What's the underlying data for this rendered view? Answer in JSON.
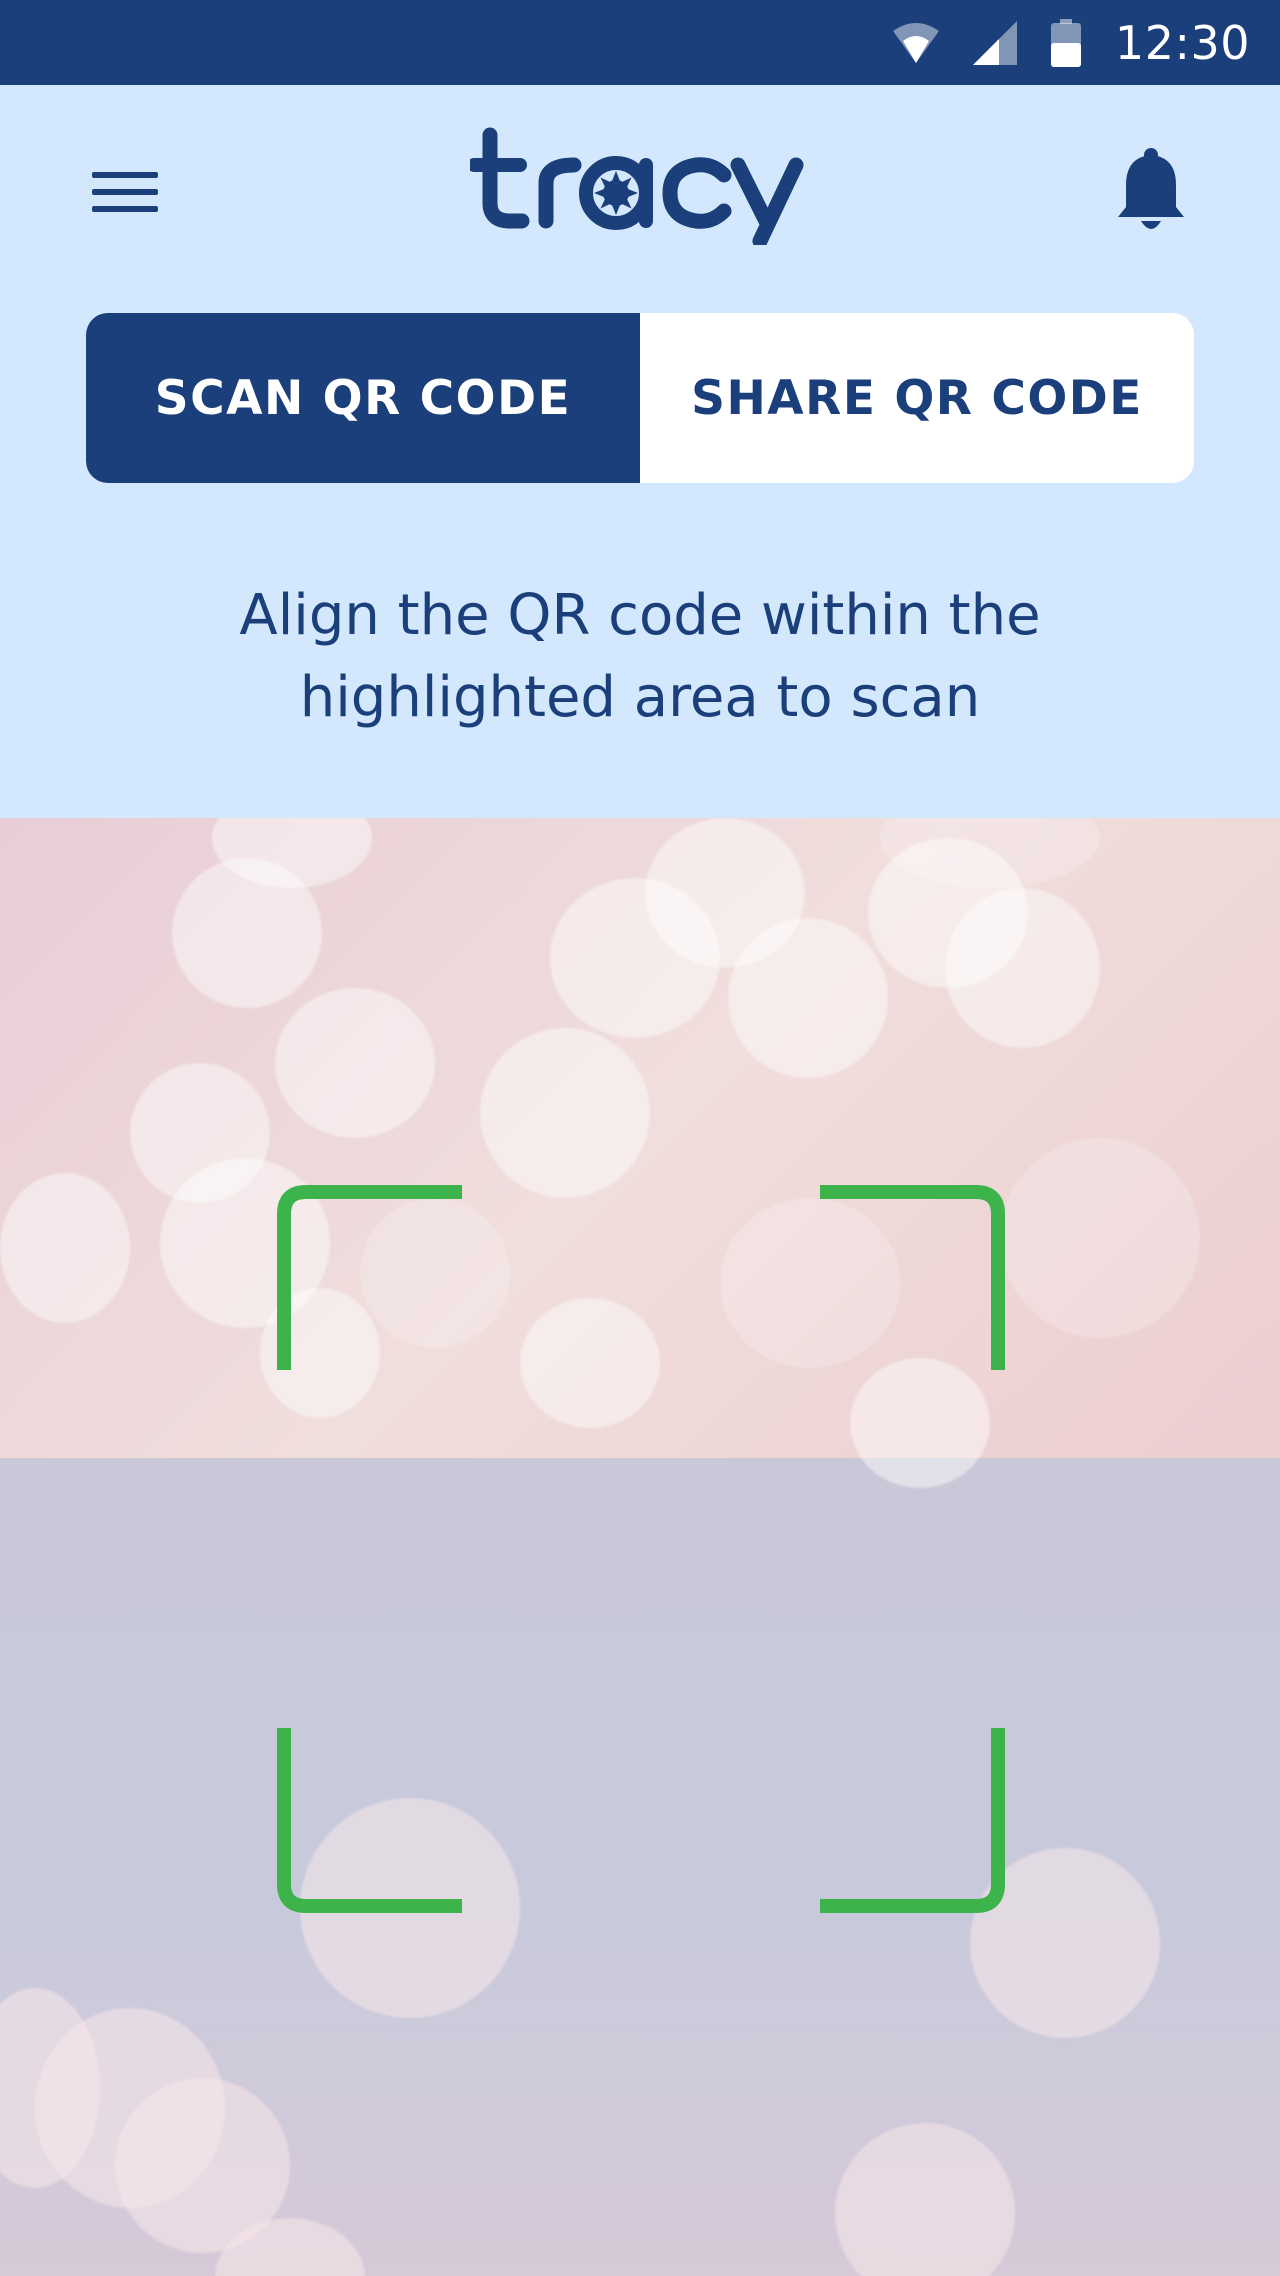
{
  "status_bar": {
    "time": "12:30",
    "icons": [
      "wifi-icon",
      "cellular-signal-icon",
      "battery-icon"
    ]
  },
  "header": {
    "logo_text": "tracy",
    "menu_icon": "hamburger-menu-icon",
    "notification_icon": "bell-icon"
  },
  "tabs": [
    {
      "label": "SCAN QR CODE",
      "active": true
    },
    {
      "label": "SHARE QR CODE",
      "active": false
    }
  ],
  "instructions": {
    "line1": "Align the QR code within the",
    "line2": "highlighted area to scan"
  },
  "scanner": {
    "frame_color": "#3cb44b"
  },
  "colors": {
    "primary": "#1a3f7a",
    "background": "#d3e8fc",
    "scan_frame": "#3cb44b"
  }
}
